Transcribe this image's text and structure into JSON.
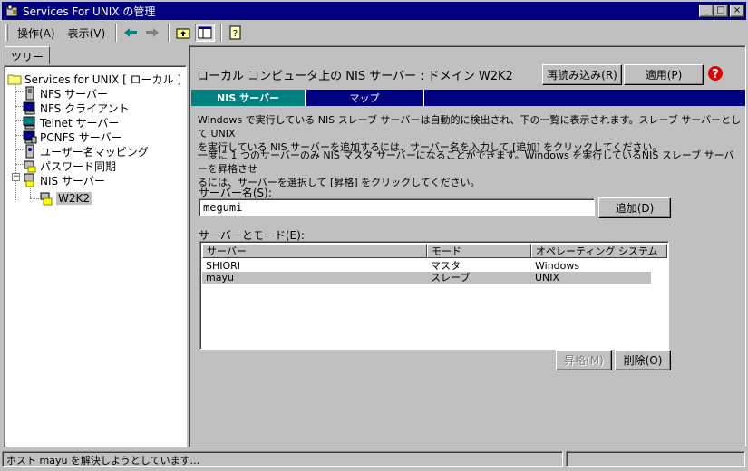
{
  "window": {
    "title": "Services For UNIX の管理",
    "minimize": "_",
    "maximize": "□",
    "close": "×"
  },
  "menu": {
    "action": "操作(A)",
    "view": "表示(V)"
  },
  "tree": {
    "tab_label": "ツリー",
    "root": "Services for UNIX [ ローカル ]",
    "items": [
      {
        "label": "NFS サーバー",
        "icon": "nfs-server-icon"
      },
      {
        "label": "NFS クライアント",
        "icon": "nfs-client-icon"
      },
      {
        "label": "Telnet サーバー",
        "icon": "telnet-server-icon"
      },
      {
        "label": "PCNFS サーバー",
        "icon": "pcnfs-server-icon"
      },
      {
        "label": "ユーザー名マッピング",
        "icon": "user-mapping-icon"
      },
      {
        "label": "パスワード同期",
        "icon": "password-sync-icon"
      },
      {
        "label": "NIS サーバー",
        "icon": "nis-server-icon"
      }
    ],
    "child": "W2K2"
  },
  "main": {
    "header": "ローカル コンピュータ上の NIS サーバー : ドメイン W2K2",
    "reload_button": "再読み込み(R)",
    "apply_button": "適用(P)",
    "tabs": [
      {
        "label": "NIS サーバー",
        "active": true
      },
      {
        "label": "マップ",
        "active": false
      }
    ],
    "para1_line1": "Windows で実行している NIS スレーブ サーバーは自動的に検出され、下の一覧に表示されます。スレーブ サーバーとして UNIX",
    "para1_line2": "を実行している NIS サーバーを追加するには、サーバー名を入力して [追加] をクリックしてください。",
    "para2_line1": "一度に 1 つのサーバーのみ NIS マスタ サーバーになることができます。Windows を実行しているNIS スレーブ サーバーを昇格させ",
    "para2_line2": "るには、サーバーを選択して [昇格] をクリックしてください。",
    "server_name_label": "サーバー名(S):",
    "server_name_value": "megumi",
    "add_button": "追加(D)",
    "list_label": "サーバーとモード(E):",
    "columns": [
      "サーバー",
      "モード",
      "オペレーティング システム"
    ],
    "rows": [
      {
        "server": "SHIORI",
        "mode": "マスタ",
        "os": "Windows",
        "selected": false
      },
      {
        "server": "mayu",
        "mode": "スレーブ",
        "os": "UNIX",
        "selected": true
      }
    ],
    "promote_button": "昇格(M)",
    "delete_button": "削除(O)"
  },
  "status": {
    "text": "ホスト mayu を解決しようとしています..."
  }
}
